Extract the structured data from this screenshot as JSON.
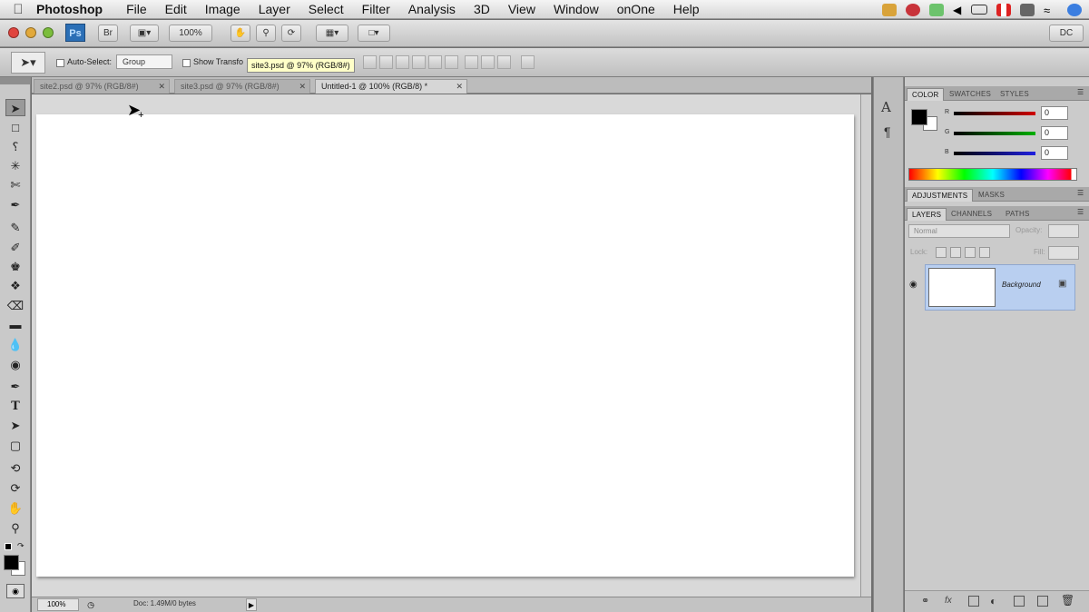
{
  "menubar": {
    "apple": "",
    "items": [
      "Photoshop",
      "File",
      "Edit",
      "Image",
      "Layer",
      "Select",
      "Filter",
      "Analysis",
      "3D",
      "View",
      "Window",
      "onOne",
      "Help"
    ]
  },
  "appbar": {
    "ps_label": "Ps",
    "br_label": "Br",
    "zoom": "100%",
    "workspace": "DC"
  },
  "options": {
    "auto_select": "Auto-Select:",
    "group": "Group",
    "show_transform": "Show Transfo"
  },
  "tooltip": "site3.psd @ 97% (RGB/8#)",
  "tabs": [
    {
      "label": "site2.psd @ 97% (RGB/8#)"
    },
    {
      "label": "site3.psd @ 97% (RGB/8#)"
    },
    {
      "label": "Untitled-1 @ 100% (RGB/8) *"
    }
  ],
  "status": {
    "zoom": "100%",
    "doc": "Doc: 1.49M/0 bytes"
  },
  "color_panel": {
    "tabs": [
      "COLOR",
      "SWATCHES",
      "STYLES"
    ],
    "channels": [
      {
        "label": "R",
        "value": "0",
        "color": "#d00000"
      },
      {
        "label": "G",
        "value": "0",
        "color": "#00b000"
      },
      {
        "label": "B",
        "value": "0",
        "color": "#2020e0"
      }
    ]
  },
  "adjust_panel": {
    "tabs": [
      "ADJUSTMENTS",
      "MASKS"
    ]
  },
  "layers_panel": {
    "tabs": [
      "LAYERS",
      "CHANNELS",
      "PATHS"
    ],
    "blend_mode": "Normal",
    "opacity_label": "Opacity:",
    "lock_label": "Lock:",
    "fill_label": "Fill:",
    "layer_name": "Background"
  },
  "colors": {
    "selection": "#b9cff0"
  }
}
